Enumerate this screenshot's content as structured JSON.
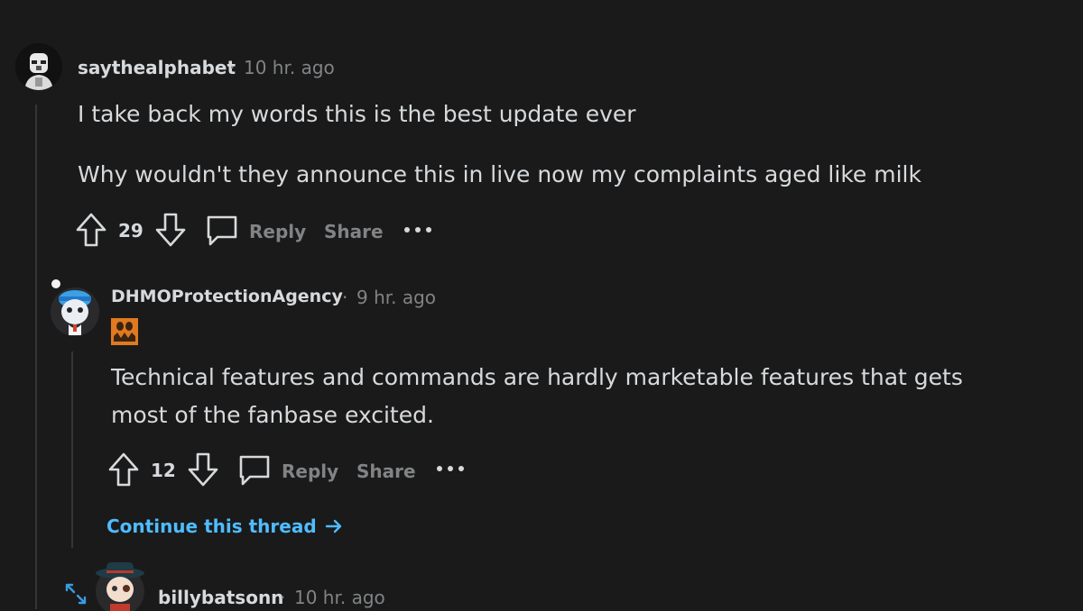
{
  "comments": [
    {
      "username": "saythealphabet",
      "separator": "·",
      "time": "10 hr. ago",
      "paragraphs": [
        "I take back my words this is the best update ever",
        "Why wouldn't they announce this in live now my complaints aged like milk"
      ],
      "score": "29",
      "reply_label": "Reply",
      "share_label": "Share"
    },
    {
      "username": "DHMOProtectionAgency",
      "separator": "·",
      "time": "9 hr. ago",
      "paragraphs": [
        "Technical features and commands are hardly marketable features that gets most of the fanbase excited."
      ],
      "score": "12",
      "reply_label": "Reply",
      "share_label": "Share",
      "continue_label": "Continue this thread"
    },
    {
      "username": "billybatsonn",
      "separator": "·",
      "time": "10 hr. ago"
    }
  ],
  "colors": {
    "background": "#1a1a1b",
    "text": "#d7dadc",
    "muted": "#818384",
    "link": "#4fbcff",
    "thread_line": "#343536"
  },
  "icons": [
    "upvote-icon",
    "downvote-icon",
    "comment-bubble-icon",
    "more-options-icon",
    "arrow-right-icon",
    "expand-icon",
    "flair-icon"
  ]
}
